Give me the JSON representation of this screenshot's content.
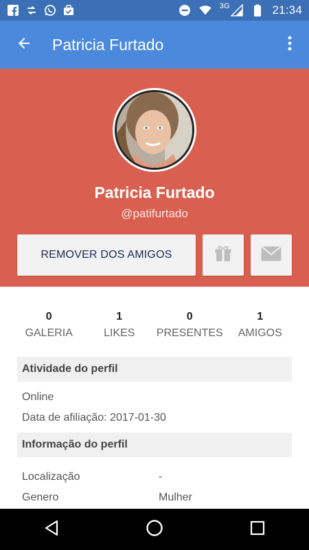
{
  "status_bar": {
    "time": "21:34",
    "network": "3G",
    "left_icons": [
      "facebook-icon",
      "sync-icon",
      "whatsapp-icon",
      "briefcase-check-icon"
    ],
    "right_icons": [
      "do-not-disturb-icon",
      "wifi-icon",
      "signal-icon",
      "battery-icon"
    ]
  },
  "app_bar": {
    "title": "Patricia Furtado",
    "back_icon": "arrow-back-icon",
    "menu_icon": "more-vert-icon",
    "color": "#4a89dc"
  },
  "profile": {
    "name": "Patricia Furtado",
    "handle": "@patifurtado",
    "header_color": "#d95f50",
    "remove_friend_label": "REMOVER DOS AMIGOS",
    "gift_icon": "gift-icon",
    "mail_icon": "mail-icon"
  },
  "stats": [
    {
      "value": "0",
      "label": "GALERIA"
    },
    {
      "value": "1",
      "label": "LIKES"
    },
    {
      "value": "0",
      "label": "PRESENTES"
    },
    {
      "value": "1",
      "label": "AMIGOS"
    }
  ],
  "activity": {
    "header": "Atividade do perfil",
    "status": "Online",
    "joined": "Data de afiliação: 2017-01-30"
  },
  "info": {
    "header": "Informação do perfil",
    "rows": [
      {
        "label": "Localização",
        "value": "-"
      },
      {
        "label": "Genero",
        "value": "Mulher"
      }
    ]
  },
  "nav_bar": {
    "icons": [
      "back-triangle-icon",
      "home-circle-icon",
      "recents-square-icon"
    ]
  }
}
